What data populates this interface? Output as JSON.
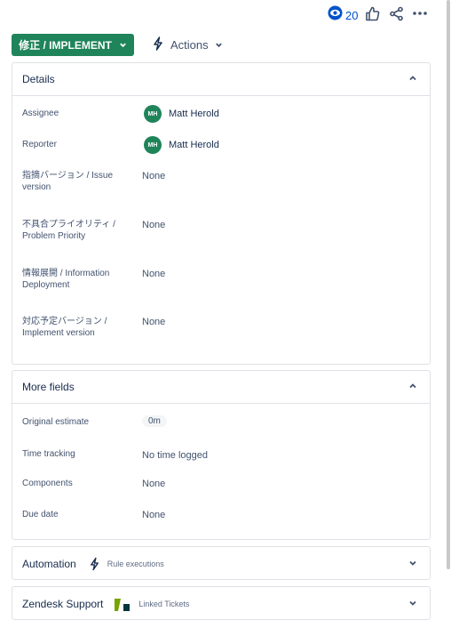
{
  "topbar": {
    "watch_count": "20"
  },
  "status_button": {
    "label": "修正 / IMPLEMENT"
  },
  "actions_button": {
    "label": "Actions"
  },
  "details": {
    "title": "Details",
    "assignee_label": "Assignee",
    "assignee_initials": "MH",
    "assignee_name": "Matt Herold",
    "reporter_label": "Reporter",
    "reporter_initials": "MH",
    "reporter_name": "Matt Herold",
    "issue_version_label_1": "指摘バージョン / Issue",
    "issue_version_label_2": "version",
    "issue_version_value": "None",
    "priority_label_1": "不具合プライオリティ /",
    "priority_label_2": "Problem Priority",
    "priority_value": "None",
    "deployment_label_1": "情報展開 / Information",
    "deployment_label_2": "Deployment",
    "deployment_value": "None",
    "implement_version_label_1": "対応予定バージョン /",
    "implement_version_label_2": "Implement version",
    "implement_version_value": "None"
  },
  "more_fields": {
    "title": "More fields",
    "original_estimate_label": "Original estimate",
    "original_estimate_value": "0m",
    "time_tracking_label": "Time tracking",
    "time_tracking_value": "No time logged",
    "components_label": "Components",
    "components_value": "None",
    "due_date_label": "Due date",
    "due_date_value": "None"
  },
  "automation": {
    "title": "Automation",
    "subtitle": "Rule executions"
  },
  "zendesk": {
    "title": "Zendesk Support",
    "subtitle": "Linked Tickets"
  },
  "colors": {
    "status_green": "#1f845a",
    "link_blue": "#0052cc",
    "border": "#dfe1e6"
  }
}
